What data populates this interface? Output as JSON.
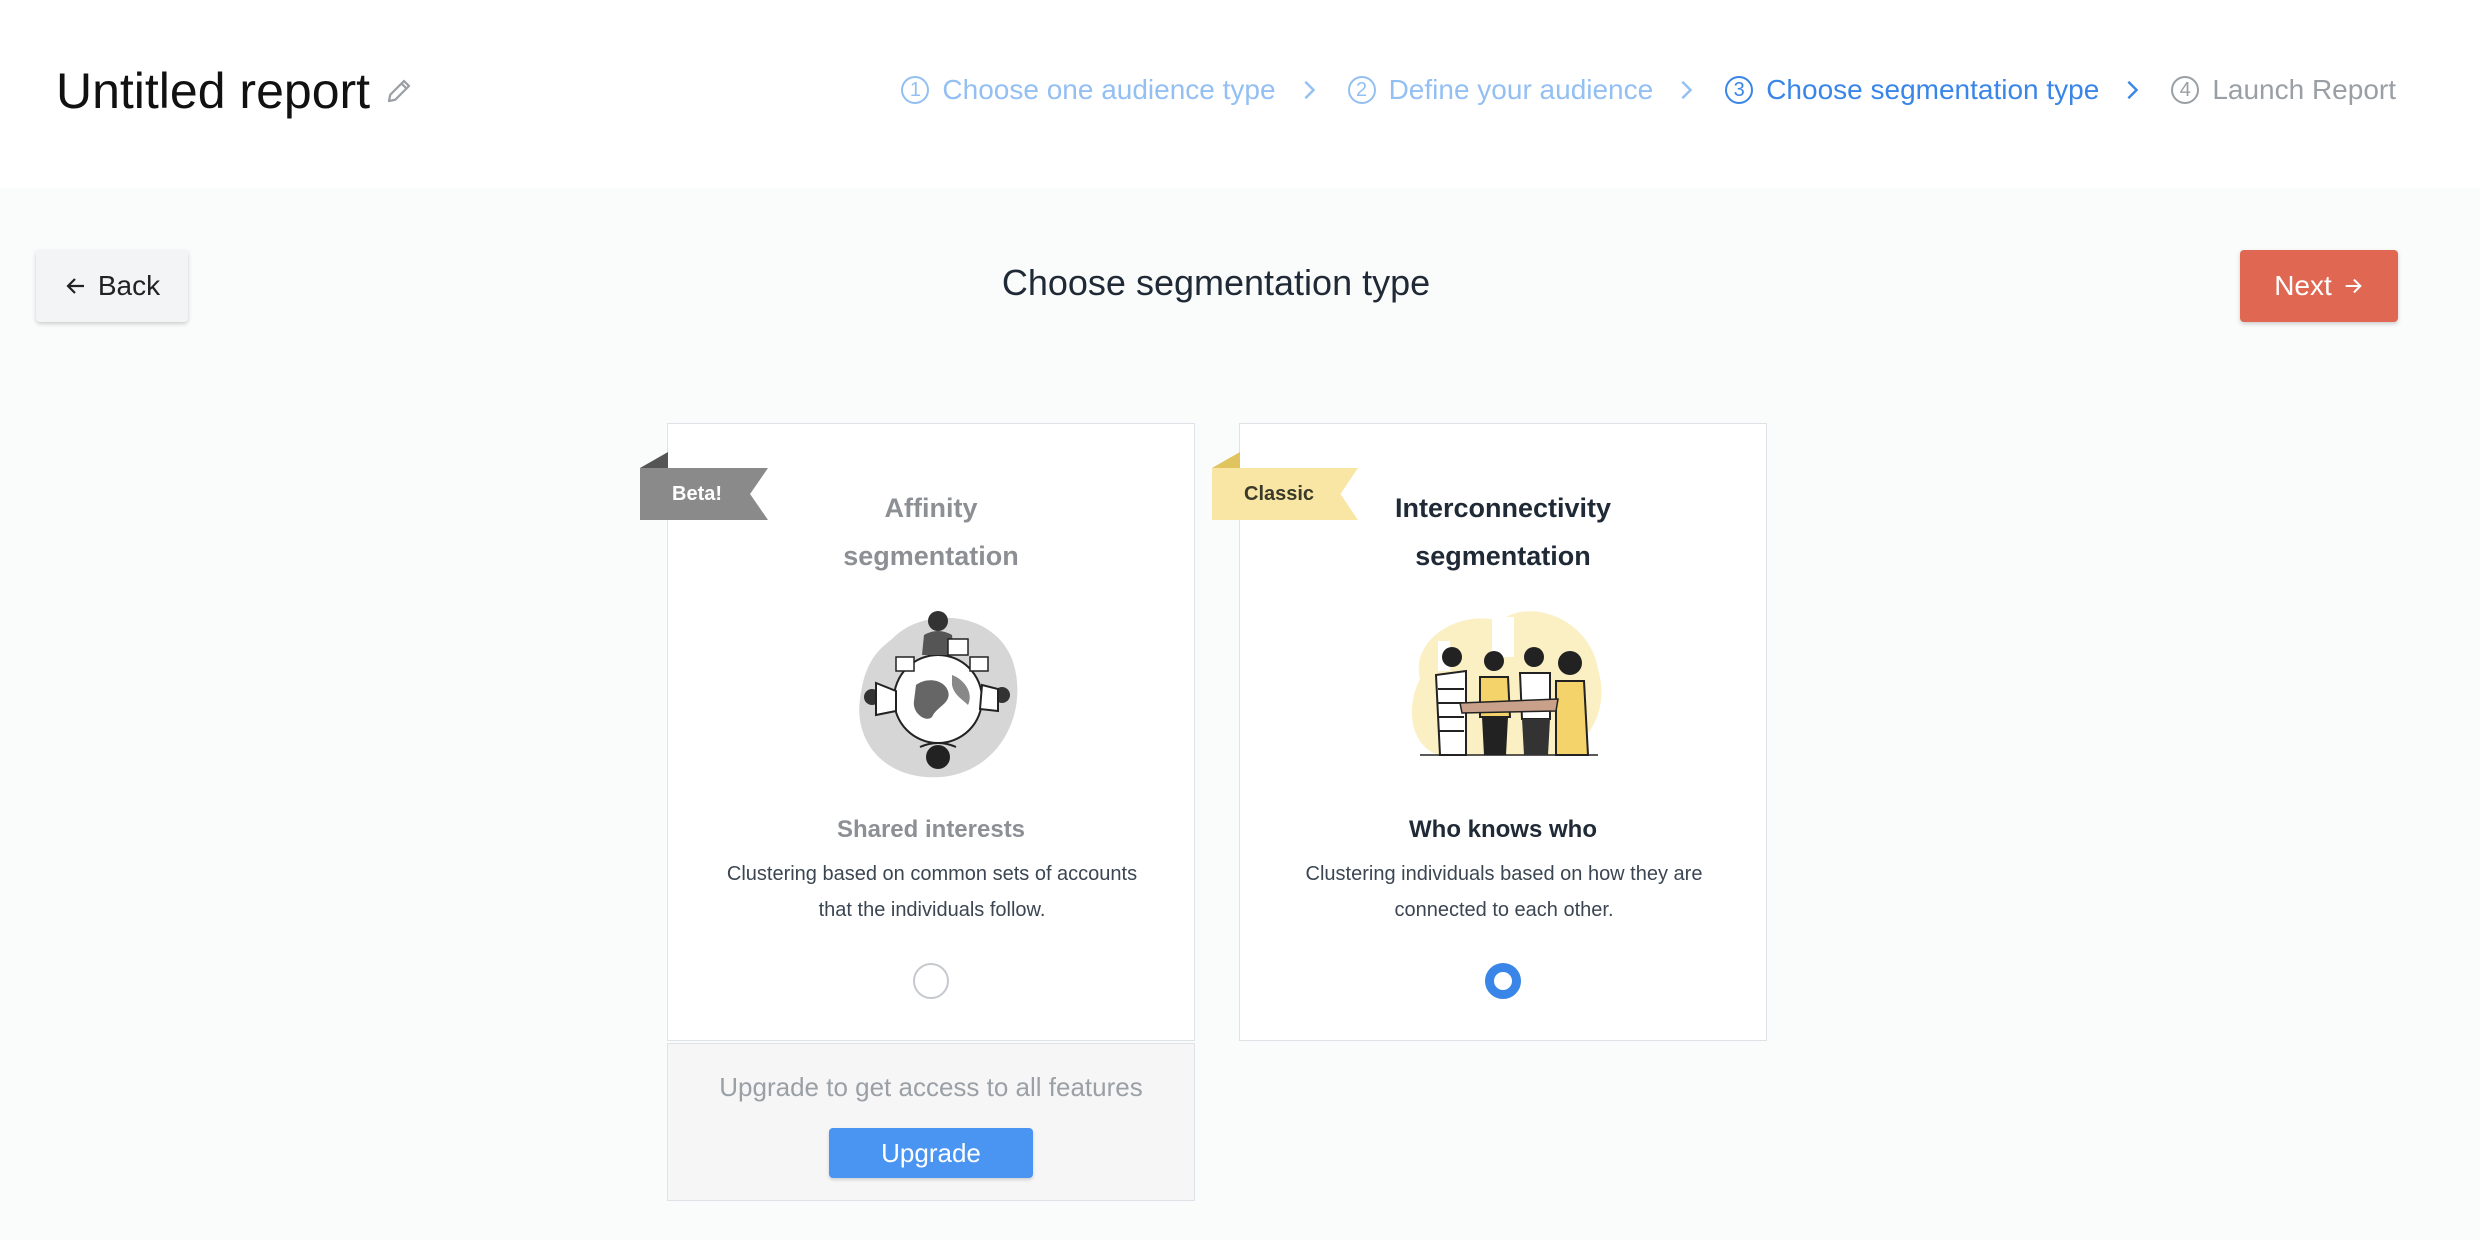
{
  "header": {
    "title": "Untitled report",
    "edit_icon": "pencil-icon",
    "steps": [
      {
        "number": "1",
        "label": "Choose one audience type",
        "state": "done"
      },
      {
        "number": "2",
        "label": "Define your audience",
        "state": "done"
      },
      {
        "number": "3",
        "label": "Choose segmentation type",
        "state": "active"
      },
      {
        "number": "4",
        "label": "Launch Report",
        "state": "todo"
      }
    ]
  },
  "toolbar": {
    "back_label": "Back",
    "back_icon": "arrow-left-icon",
    "heading": "Choose segmentation type",
    "next_label": "Next",
    "next_icon": "arrow-right-icon"
  },
  "cards": [
    {
      "ribbon": "Beta!",
      "title_line1": "Affinity",
      "title_line2": "segmentation",
      "subtitle": "Shared interests",
      "description_line1": "Clustering based on common sets of accounts",
      "description_line2": "that the individuals follow.",
      "selected": false
    },
    {
      "ribbon": "Classic",
      "title_line1": "Interconnectivity",
      "title_line2": "segmentation",
      "subtitle": "Who knows who",
      "description_line1": "Clustering individuals based on how they are",
      "description_line2": "connected to each other.",
      "selected": true
    }
  ],
  "upgrade": {
    "text": "Upgrade to get access to all features",
    "button_label": "Upgrade"
  },
  "colors": {
    "accent_blue": "#3a86e8",
    "next_button": "#e06852",
    "upgrade_button": "#4b95f2",
    "beta_ribbon": "#8a8a8a",
    "classic_ribbon": "#f9e6a4"
  }
}
